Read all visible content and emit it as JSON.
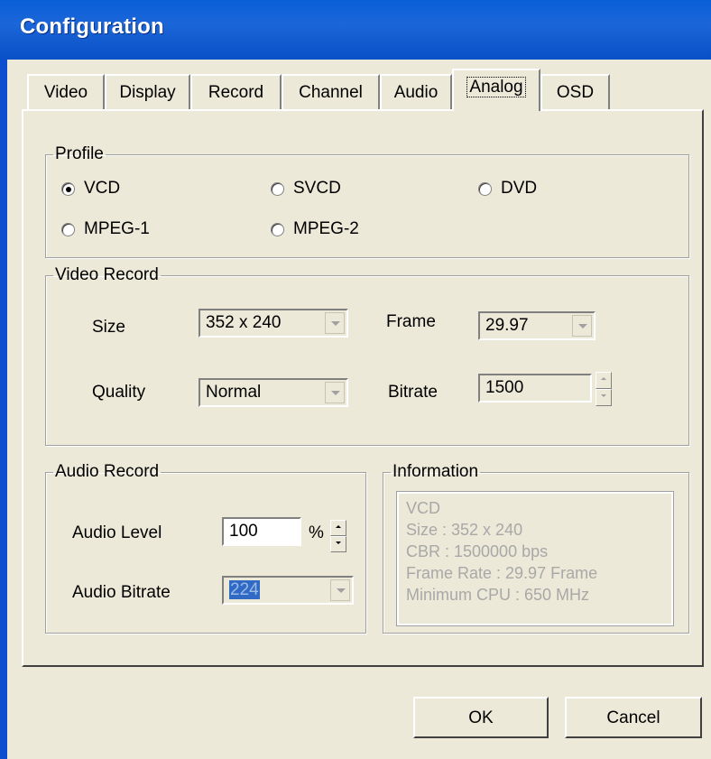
{
  "window": {
    "title": "Configuration"
  },
  "tabs": [
    {
      "label": "Video"
    },
    {
      "label": "Display"
    },
    {
      "label": "Record"
    },
    {
      "label": "Channel"
    },
    {
      "label": "Audio"
    },
    {
      "label": "Analog",
      "active": true
    },
    {
      "label": "OSD"
    }
  ],
  "profile": {
    "legend": "Profile",
    "options": [
      {
        "label": "VCD",
        "selected": true
      },
      {
        "label": "SVCD",
        "selected": false
      },
      {
        "label": "DVD",
        "selected": false
      },
      {
        "label": "MPEG-1",
        "selected": false
      },
      {
        "label": "MPEG-2",
        "selected": false
      }
    ]
  },
  "video_record": {
    "legend": "Video Record",
    "size_label": "Size",
    "size_value": "352 x 240",
    "frame_label": "Frame",
    "frame_value": "29.97",
    "quality_label": "Quality",
    "quality_value": "Normal",
    "bitrate_label": "Bitrate",
    "bitrate_value": "1500"
  },
  "audio_record": {
    "legend": "Audio Record",
    "level_label": "Audio Level",
    "level_value": "100",
    "level_unit": "%",
    "bitrate_label": "Audio Bitrate",
    "bitrate_value": "224"
  },
  "information": {
    "legend": "Information",
    "lines": [
      "VCD",
      "Size : 352 x 240",
      "CBR : 1500000 bps",
      "Frame Rate : 29.97 Frame",
      "Minimum CPU : 650 MHz"
    ]
  },
  "buttons": {
    "ok": "OK",
    "cancel": "Cancel"
  },
  "colors": {
    "titlebar": "#0a5fd8",
    "face": "#ece9d8",
    "selection": "#316ac5"
  }
}
